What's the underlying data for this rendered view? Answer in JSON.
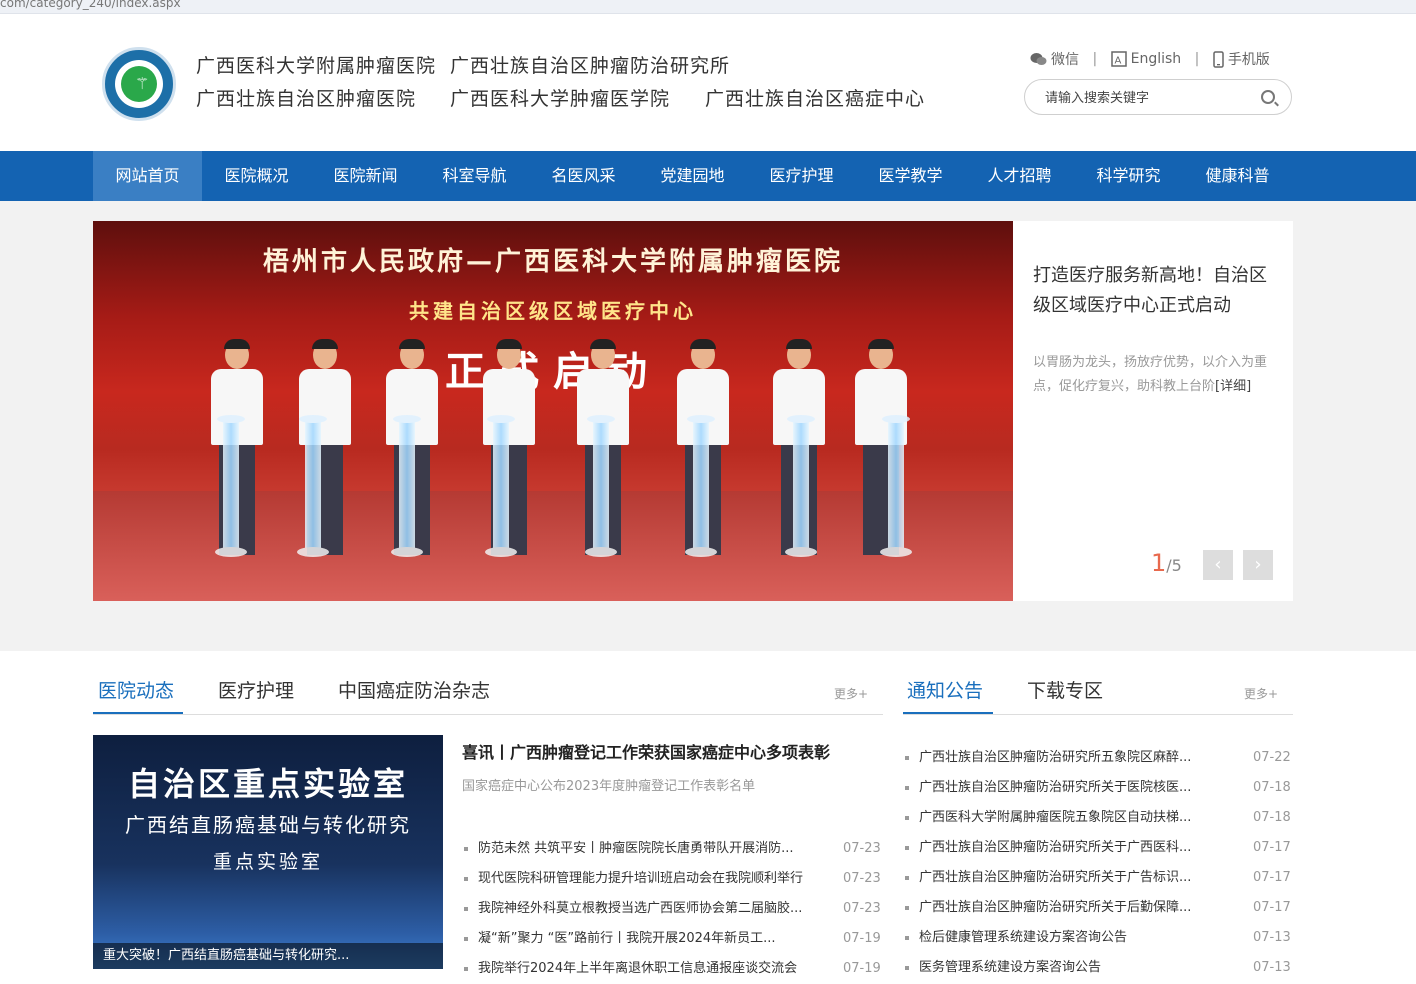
{
  "browser": {
    "url_fragment": "com/category_240/index.aspx"
  },
  "header": {
    "names": [
      "广西医科大学附属肿瘤医院",
      "广西壮族自治区肿瘤防治研究所",
      "广西壮族自治区肿瘤医院",
      "广西医科大学肿瘤医学院",
      "广西壮族自治区癌症中心"
    ],
    "tools": {
      "wechat": "微信",
      "english": "English",
      "mobile": "手机版",
      "divider": "|"
    },
    "search_placeholder": "请输入搜索关键字"
  },
  "nav": [
    "网站首页",
    "医院概况",
    "医院新闻",
    "科室导航",
    "名医风采",
    "党建园地",
    "医疗护理",
    "医学教学",
    "人才招聘",
    "科学研究",
    "健康科普"
  ],
  "slider": {
    "image_text": {
      "line1": "梧州市人民政府—广西医科大学附属肿瘤医院",
      "line2": "共建自治区级区域医疗中心",
      "line3": "正式启动"
    },
    "title": "打造医疗服务新高地！自治区级区域医疗中心正式启动",
    "desc": "以胃肠为龙头，扬放疗优势，以介入为重点，促化疗复兴，助科教上台阶",
    "detail_link": "[详细]",
    "current": "1",
    "total": "/5",
    "prev_icon": "‹",
    "next_icon": "›"
  },
  "news": {
    "tabs": [
      "医院动态",
      "医疗护理",
      "中国癌症防治杂志"
    ],
    "more": "更多+",
    "image_text": {
      "line1": "自治区重点实验室",
      "line2": "广西结直肠癌基础与转化研究",
      "line3": "重点实验室"
    },
    "image_caption": "重大突破！广西结直肠癌基础与转化研究...",
    "headline": "喜讯丨广西肿瘤登记工作荣获国家癌症中心多项表彰",
    "summary": "国家癌症中心公布2023年度肿瘤登记工作表彰名单",
    "items": [
      {
        "title": "防范未然 共筑平安丨肿瘤医院院长唐勇带队开展消防...",
        "date": "07-23"
      },
      {
        "title": "现代医院科研管理能力提升培训班启动会在我院顺利举行",
        "date": "07-23"
      },
      {
        "title": "我院神经外科莫立根教授当选广西医师协会第二届脑胶...",
        "date": "07-23"
      },
      {
        "title": "凝“新”聚力 “医”路前行丨我院开展2024年新员工...",
        "date": "07-19"
      },
      {
        "title": "我院举行2024年上半年离退休职工信息通报座谈交流会",
        "date": "07-19"
      }
    ]
  },
  "notice": {
    "tabs": [
      "通知公告",
      "下载专区"
    ],
    "more": "更多+",
    "items": [
      {
        "title": "广西壮族自治区肿瘤防治研究所五象院区麻醉...",
        "date": "07-22"
      },
      {
        "title": "广西壮族自治区肿瘤防治研究所关于医院核医...",
        "date": "07-18"
      },
      {
        "title": "广西医科大学附属肿瘤医院五象院区自动扶梯...",
        "date": "07-18"
      },
      {
        "title": "广西壮族自治区肿瘤防治研究所关于广西医科...",
        "date": "07-17"
      },
      {
        "title": "广西壮族自治区肿瘤防治研究所关于广告标识...",
        "date": "07-17"
      },
      {
        "title": "广西壮族自治区肿瘤防治研究所关于后勤保障...",
        "date": "07-17"
      },
      {
        "title": "检后健康管理系统建设方案咨询公告",
        "date": "07-13"
      },
      {
        "title": "医务管理系统建设方案咨询公告",
        "date": "07-13"
      }
    ]
  },
  "colors": {
    "primary": "#1463b2",
    "nav_active": "#3a7fc4",
    "accent": "#e8694d",
    "tab_active": "#1a6fbd"
  }
}
